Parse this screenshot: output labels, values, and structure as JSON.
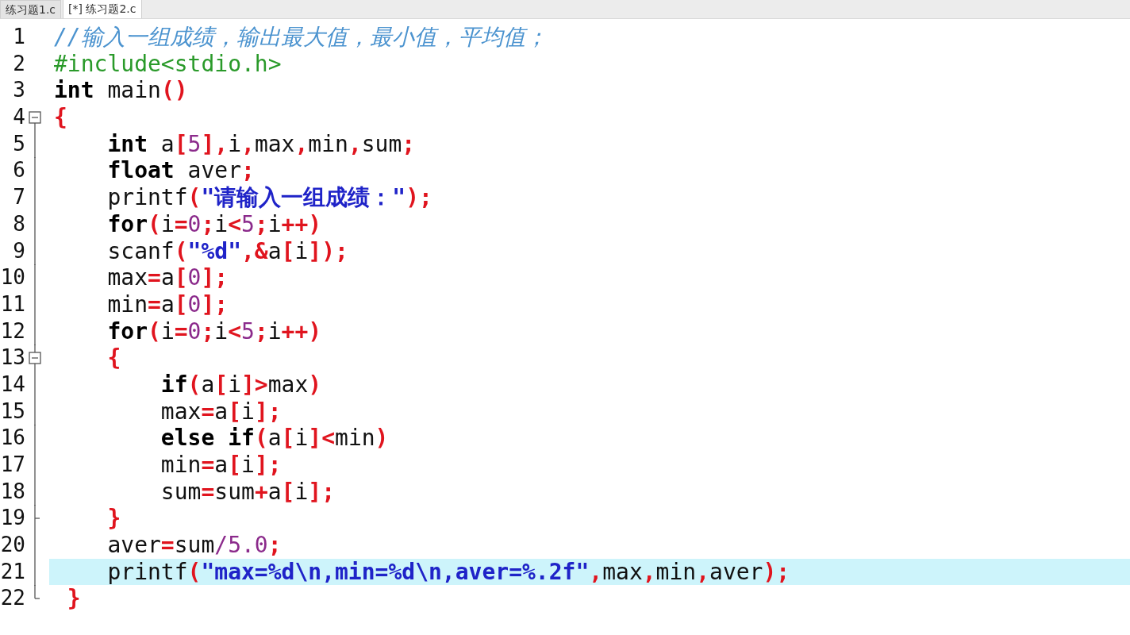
{
  "tabs": [
    {
      "label": "练习题1.c",
      "selected": false
    },
    {
      "label": "[*] 练习题2.c",
      "selected": true
    }
  ],
  "lines": [
    {
      "number": "1",
      "kind": "plain",
      "highlighted": false,
      "tokens": [
        {
          "kind": "comment",
          "text": "//输入一组成绩，输出最大值，最小值，平均值；"
        }
      ]
    },
    {
      "number": "2",
      "kind": "plain",
      "highlighted": false,
      "tokens": [
        {
          "kind": "preprocessor",
          "text": "#include<stdio.h>"
        }
      ]
    },
    {
      "number": "3",
      "kind": "plain",
      "highlighted": false,
      "tokens": [
        {
          "kind": "keyword",
          "text": "int"
        },
        {
          "kind": "plain",
          "text": " main"
        },
        {
          "kind": "symbol",
          "text": "()"
        }
      ]
    },
    {
      "number": "4",
      "kind": "fold-start",
      "highlighted": false,
      "tokens": [
        {
          "kind": "symbol",
          "text": "{"
        }
      ]
    },
    {
      "number": "5",
      "kind": "fold-inner",
      "highlighted": false,
      "tokens": [
        {
          "kind": "keyword",
          "text": "    int"
        },
        {
          "kind": "plain",
          "text": " a"
        },
        {
          "kind": "symbol",
          "text": "["
        },
        {
          "kind": "number",
          "text": "5"
        },
        {
          "kind": "symbol",
          "text": "],"
        },
        {
          "kind": "plain",
          "text": "i"
        },
        {
          "kind": "symbol",
          "text": ","
        },
        {
          "kind": "plain",
          "text": "max"
        },
        {
          "kind": "symbol",
          "text": ","
        },
        {
          "kind": "plain",
          "text": "min"
        },
        {
          "kind": "symbol",
          "text": ","
        },
        {
          "kind": "plain",
          "text": "sum"
        },
        {
          "kind": "symbol",
          "text": ";"
        }
      ]
    },
    {
      "number": "6",
      "kind": "fold-inner",
      "highlighted": false,
      "tokens": [
        {
          "kind": "keyword",
          "text": "    float"
        },
        {
          "kind": "plain",
          "text": " aver"
        },
        {
          "kind": "symbol",
          "text": ";"
        }
      ]
    },
    {
      "number": "7",
      "kind": "fold-inner",
      "highlighted": false,
      "tokens": [
        {
          "kind": "plain",
          "text": "    printf"
        },
        {
          "kind": "symbol",
          "text": "("
        },
        {
          "kind": "string",
          "text": "\"请输入一组成绩：\""
        },
        {
          "kind": "symbol",
          "text": ");"
        }
      ]
    },
    {
      "number": "8",
      "kind": "fold-inner",
      "highlighted": false,
      "tokens": [
        {
          "kind": "keyword",
          "text": "    for"
        },
        {
          "kind": "symbol",
          "text": "("
        },
        {
          "kind": "plain",
          "text": "i"
        },
        {
          "kind": "symbol",
          "text": "="
        },
        {
          "kind": "number",
          "text": "0"
        },
        {
          "kind": "symbol",
          "text": ";"
        },
        {
          "kind": "plain",
          "text": "i"
        },
        {
          "kind": "symbol",
          "text": "<"
        },
        {
          "kind": "number",
          "text": "5"
        },
        {
          "kind": "symbol",
          "text": ";"
        },
        {
          "kind": "plain",
          "text": "i"
        },
        {
          "kind": "symbol",
          "text": "++)"
        }
      ]
    },
    {
      "number": "9",
      "kind": "fold-inner",
      "highlighted": false,
      "tokens": [
        {
          "kind": "plain",
          "text": "    scanf"
        },
        {
          "kind": "symbol",
          "text": "("
        },
        {
          "kind": "string",
          "text": "\"%d\""
        },
        {
          "kind": "symbol",
          "text": ",&"
        },
        {
          "kind": "plain",
          "text": "a"
        },
        {
          "kind": "symbol",
          "text": "["
        },
        {
          "kind": "plain",
          "text": "i"
        },
        {
          "kind": "symbol",
          "text": "]);"
        }
      ]
    },
    {
      "number": "10",
      "kind": "fold-inner",
      "highlighted": false,
      "tokens": [
        {
          "kind": "plain",
          "text": "    max"
        },
        {
          "kind": "symbol",
          "text": "="
        },
        {
          "kind": "plain",
          "text": "a"
        },
        {
          "kind": "symbol",
          "text": "["
        },
        {
          "kind": "number",
          "text": "0"
        },
        {
          "kind": "symbol",
          "text": "];"
        }
      ]
    },
    {
      "number": "11",
      "kind": "fold-inner",
      "highlighted": false,
      "tokens": [
        {
          "kind": "plain",
          "text": "    min"
        },
        {
          "kind": "symbol",
          "text": "="
        },
        {
          "kind": "plain",
          "text": "a"
        },
        {
          "kind": "symbol",
          "text": "["
        },
        {
          "kind": "number",
          "text": "0"
        },
        {
          "kind": "symbol",
          "text": "];"
        }
      ]
    },
    {
      "number": "12",
      "kind": "fold-inner",
      "highlighted": false,
      "tokens": [
        {
          "kind": "keyword",
          "text": "    for"
        },
        {
          "kind": "symbol",
          "text": "("
        },
        {
          "kind": "plain",
          "text": "i"
        },
        {
          "kind": "symbol",
          "text": "="
        },
        {
          "kind": "number",
          "text": "0"
        },
        {
          "kind": "symbol",
          "text": ";"
        },
        {
          "kind": "plain",
          "text": "i"
        },
        {
          "kind": "symbol",
          "text": "<"
        },
        {
          "kind": "number",
          "text": "5"
        },
        {
          "kind": "symbol",
          "text": ";"
        },
        {
          "kind": "plain",
          "text": "i"
        },
        {
          "kind": "symbol",
          "text": "++)"
        }
      ]
    },
    {
      "number": "13",
      "kind": "fold-start",
      "highlighted": false,
      "tokens": [
        {
          "kind": "symbol",
          "text": "    {"
        }
      ]
    },
    {
      "number": "14",
      "kind": "fold-inner",
      "highlighted": false,
      "tokens": [
        {
          "kind": "keyword",
          "text": "        if"
        },
        {
          "kind": "symbol",
          "text": "("
        },
        {
          "kind": "plain",
          "text": "a"
        },
        {
          "kind": "symbol",
          "text": "["
        },
        {
          "kind": "plain",
          "text": "i"
        },
        {
          "kind": "symbol",
          "text": "]>"
        },
        {
          "kind": "plain",
          "text": "max"
        },
        {
          "kind": "symbol",
          "text": ")"
        }
      ]
    },
    {
      "number": "15",
      "kind": "fold-inner",
      "highlighted": false,
      "tokens": [
        {
          "kind": "plain",
          "text": "        max"
        },
        {
          "kind": "symbol",
          "text": "="
        },
        {
          "kind": "plain",
          "text": "a"
        },
        {
          "kind": "symbol",
          "text": "["
        },
        {
          "kind": "plain",
          "text": "i"
        },
        {
          "kind": "symbol",
          "text": "];"
        }
      ]
    },
    {
      "number": "16",
      "kind": "fold-inner",
      "highlighted": false,
      "tokens": [
        {
          "kind": "keyword",
          "text": "        else if"
        },
        {
          "kind": "symbol",
          "text": "("
        },
        {
          "kind": "plain",
          "text": "a"
        },
        {
          "kind": "symbol",
          "text": "["
        },
        {
          "kind": "plain",
          "text": "i"
        },
        {
          "kind": "symbol",
          "text": "]<"
        },
        {
          "kind": "plain",
          "text": "min"
        },
        {
          "kind": "symbol",
          "text": ")"
        }
      ]
    },
    {
      "number": "17",
      "kind": "fold-inner",
      "highlighted": false,
      "tokens": [
        {
          "kind": "plain",
          "text": "        min"
        },
        {
          "kind": "symbol",
          "text": "="
        },
        {
          "kind": "plain",
          "text": "a"
        },
        {
          "kind": "symbol",
          "text": "["
        },
        {
          "kind": "plain",
          "text": "i"
        },
        {
          "kind": "symbol",
          "text": "];"
        }
      ]
    },
    {
      "number": "18",
      "kind": "fold-inner",
      "highlighted": false,
      "tokens": [
        {
          "kind": "plain",
          "text": "        sum"
        },
        {
          "kind": "symbol",
          "text": "="
        },
        {
          "kind": "plain",
          "text": "sum"
        },
        {
          "kind": "symbol",
          "text": "+"
        },
        {
          "kind": "plain",
          "text": "a"
        },
        {
          "kind": "symbol",
          "text": "["
        },
        {
          "kind": "plain",
          "text": "i"
        },
        {
          "kind": "symbol",
          "text": "];"
        }
      ]
    },
    {
      "number": "19",
      "kind": "fold-inner-end",
      "highlighted": false,
      "tokens": [
        {
          "kind": "symbol",
          "text": "    }"
        }
      ]
    },
    {
      "number": "20",
      "kind": "fold-inner",
      "highlighted": false,
      "tokens": [
        {
          "kind": "plain",
          "text": "    aver"
        },
        {
          "kind": "symbol",
          "text": "="
        },
        {
          "kind": "plain",
          "text": "sum"
        },
        {
          "kind": "number",
          "text": "/5.0"
        },
        {
          "kind": "symbol",
          "text": ";"
        }
      ]
    },
    {
      "number": "21",
      "kind": "fold-inner",
      "highlighted": true,
      "tokens": [
        {
          "kind": "plain",
          "text": "    printf"
        },
        {
          "kind": "symbol",
          "text": "("
        },
        {
          "kind": "string",
          "text": "\"max=%d\\n,min=%d\\n,aver=%.2f\""
        },
        {
          "kind": "symbol",
          "text": ","
        },
        {
          "kind": "plain",
          "text": "max"
        },
        {
          "kind": "symbol",
          "text": ","
        },
        {
          "kind": "plain",
          "text": "min"
        },
        {
          "kind": "symbol",
          "text": ","
        },
        {
          "kind": "plain",
          "text": "aver"
        },
        {
          "kind": "symbol",
          "text": ");"
        }
      ]
    },
    {
      "number": "22",
      "kind": "fold-end",
      "highlighted": false,
      "tokens": [
        {
          "kind": "symbol",
          "text": " }"
        }
      ]
    }
  ]
}
